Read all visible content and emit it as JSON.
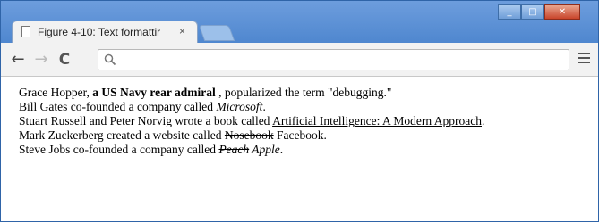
{
  "tab": {
    "title": "Figure 4-10: Text formattir",
    "close": "×"
  },
  "window_controls": {
    "minimize": "_",
    "maximize": "□",
    "close": "✕"
  },
  "toolbar": {
    "back": "←",
    "forward": "→",
    "reload": "C",
    "address_value": ""
  },
  "content": {
    "line1": {
      "a": "Grace Hopper, ",
      "b": "a US Navy rear admiral",
      "c": " , popularized the term \"debugging.\""
    },
    "line2": {
      "a": "Bill Gates co-founded a company called ",
      "b": "Microsoft",
      "c": "."
    },
    "line3": {
      "a": "Stuart Russell and Peter Norvig wrote a book called ",
      "b": "Artificial Intelligence: A Modern Approach",
      "c": "."
    },
    "line4": {
      "a": "Mark Zuckerberg created a website called ",
      "b": "Nosebook",
      "c": " Facebook."
    },
    "line5": {
      "a": "Steve Jobs co-founded a company called ",
      "b": "Peach",
      "c": " Apple",
      "d": "."
    }
  }
}
